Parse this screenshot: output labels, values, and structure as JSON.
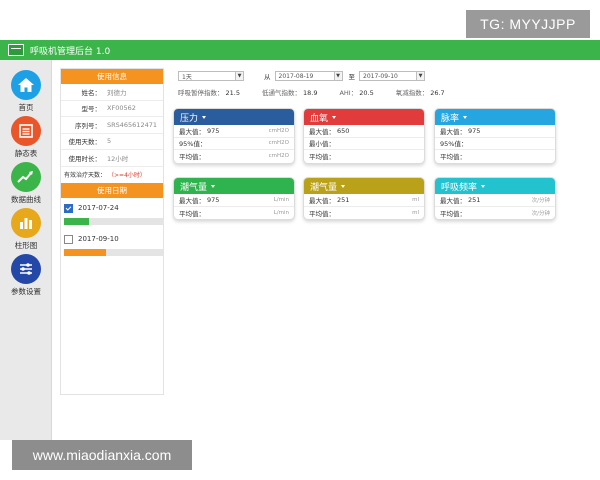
{
  "watermark_top": "TG: MYYJJPP",
  "watermark_bottom": "www.miaodianxia.com",
  "app": {
    "title": "呼吸机管理后台 1.0"
  },
  "sidebar": {
    "items": [
      {
        "label": "首页",
        "icon": "home-icon",
        "color": "#1ea0e6"
      },
      {
        "label": "静态表",
        "icon": "table-icon",
        "color": "#e8562a"
      },
      {
        "label": "数据曲线",
        "icon": "trend-icon",
        "color": "#3bb54a"
      },
      {
        "label": "柱形图",
        "icon": "bar-chart-icon",
        "color": "#e8a81c"
      },
      {
        "label": "参数设置",
        "icon": "sliders-icon",
        "color": "#2448a8"
      }
    ]
  },
  "info": {
    "header": "使用信息",
    "rows": [
      {
        "key": "姓名：",
        "value": "刘德力"
      },
      {
        "key": "型号：",
        "value": "XF00562"
      },
      {
        "key": "序列号：",
        "value": "SRS465612471"
      },
      {
        "key": "使用天数：",
        "value": "5"
      },
      {
        "key": "使用时长：",
        "value": "12小时"
      }
    ],
    "note_label": "有效治疗天数：",
    "note_value": "（>=4小时）"
  },
  "dates": {
    "header": "使用日期",
    "items": [
      {
        "date": "2017-07-24",
        "checked": true,
        "progress": 0.25,
        "color": "#3bb54a"
      },
      {
        "date": "2017-09-10",
        "checked": false,
        "progress": 0.42,
        "color": "#f4931f"
      }
    ]
  },
  "filters": {
    "range": "1天",
    "from_label": "从",
    "from_date": "2017-08-19",
    "to_label": "至",
    "to_date": "2017-09-10"
  },
  "stats": {
    "pause_label": "呼吸暂停指数：",
    "pause_value": "21.5",
    "low_label": "低通气指数：",
    "low_value": "18.9",
    "ahi_label": "AHI：",
    "ahi_value": "20.5",
    "oxy_label": "氧减指数：",
    "oxy_value": "26.7"
  },
  "cards": [
    {
      "title": "压力",
      "color": "#2a5d9e",
      "rows": [
        {
          "label": "最大值：",
          "value": "975",
          "unit": "cmH2O"
        },
        {
          "label": "95%值：",
          "value": "",
          "unit": "cmH2O"
        },
        {
          "label": "平均值：",
          "value": "",
          "unit": "cmH2O"
        }
      ]
    },
    {
      "title": "血氧",
      "color": "#e23b3b",
      "rows": [
        {
          "label": "最大值：",
          "value": "650",
          "unit": ""
        },
        {
          "label": "最小值：",
          "value": "",
          "unit": ""
        },
        {
          "label": "平均值：",
          "value": "",
          "unit": ""
        }
      ]
    },
    {
      "title": "脉率",
      "color": "#25a6e0",
      "rows": [
        {
          "label": "最大值：",
          "value": "975",
          "unit": ""
        },
        {
          "label": "95%值：",
          "value": "",
          "unit": ""
        },
        {
          "label": "平均值：",
          "value": "",
          "unit": ""
        }
      ]
    },
    {
      "title": "潮气量",
      "color": "#2fb34f",
      "rows": [
        {
          "label": "最大值：",
          "value": "975",
          "unit": "L/min"
        },
        {
          "label": "平均值：",
          "value": "",
          "unit": "L/min"
        }
      ]
    },
    {
      "title": "潮气量",
      "color": "#b9a11a",
      "rows": [
        {
          "label": "最大值：",
          "value": "251",
          "unit": "ml"
        },
        {
          "label": "平均值：",
          "value": "",
          "unit": "ml"
        }
      ]
    },
    {
      "title": "呼吸频率",
      "color": "#22c2cf",
      "rows": [
        {
          "label": "最大值：",
          "value": "251",
          "unit": "次/分钟"
        },
        {
          "label": "平均值：",
          "value": "",
          "unit": "次/分钟"
        }
      ]
    }
  ]
}
